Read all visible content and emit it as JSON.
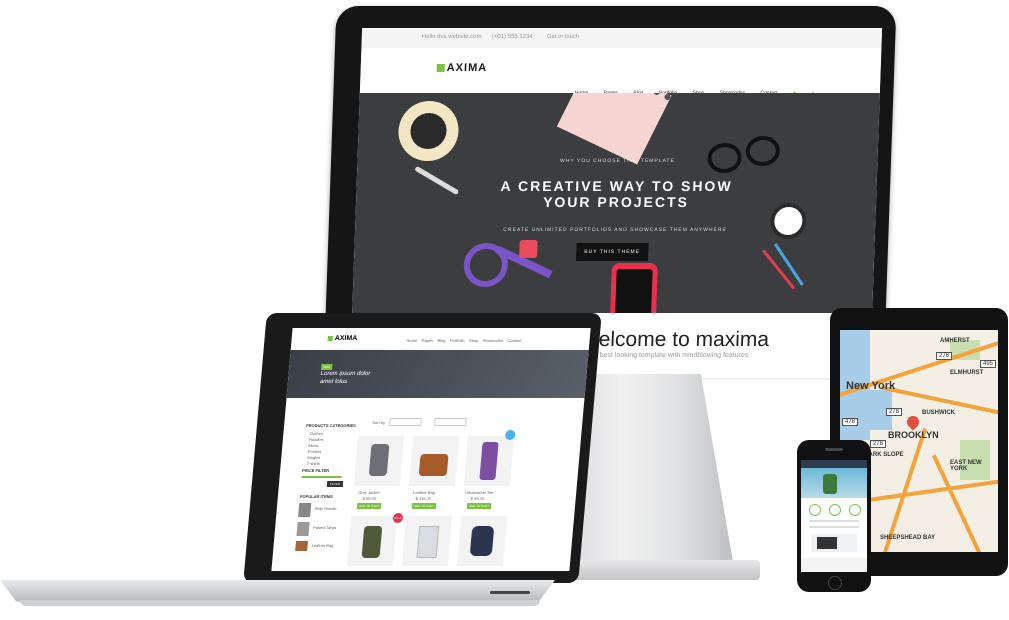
{
  "monitor": {
    "topbar": {
      "contact_email": "Hello this.website.com",
      "phone": "(+01) 555 1234",
      "address": "Get in touch"
    },
    "logo": "AXIMA",
    "nav": [
      "Home",
      "Pages",
      "Blog",
      "Portfolio",
      "Shop",
      "Shortcodes",
      "Contact"
    ],
    "hero": {
      "eyebrow": "WHY YOU CHOOSE THIS TEMPLATE",
      "title_line1": "A CREATIVE WAY TO SHOW",
      "title_line2": "YOUR PROJECTS",
      "subtitle": "CREATE UNLIMITED PORTFOLIOS AND SHOWCASE THEM ANYWHERE",
      "button": "BUY THIS THEME"
    },
    "welcome": {
      "title": "Welcome to maxima",
      "subtitle": "The best looking template with mindblowing features"
    }
  },
  "laptop": {
    "logo": "AXIMA",
    "nav": [
      "Home",
      "Pages",
      "Blog",
      "Portfolio",
      "Shop",
      "Shortcodes",
      "Contact"
    ],
    "hero_text_line1": "Lorem ipsum dolor",
    "hero_text_line2": "amet lolus",
    "badge": "NEW",
    "sidebar_title": "PRODUCTS CATEGORIES",
    "categories": [
      "Clothes",
      "Hoodies",
      "Music",
      "Posters",
      "Singles",
      "T-shirts"
    ],
    "price_filter": "PRICE FILTER",
    "filter_button": "FILTER",
    "popular_title": "POPULAR ITEMS",
    "popular_items": [
      "Ship Hoodie",
      "Patient Ninja",
      "Leather Bag"
    ],
    "sort_label": "Sort by",
    "products": [
      {
        "name": "Grey Jacket",
        "price": "$ 59.00",
        "button": "ADD TO CART"
      },
      {
        "name": "Leather Bag",
        "price": "$ 115.00",
        "button": "ADD TO CART"
      },
      {
        "name": "Ultramarine Tee",
        "price": "$ 29.00",
        "button": "ADD TO CART"
      }
    ],
    "sale_badge": "SALE"
  },
  "tablet": {
    "map_labels": [
      "New York",
      "BROOKLYN",
      "BUSHWICK",
      "EAST NEW YORK",
      "PARK SLOPE",
      "SHEEPSHEAD BAY",
      "AMHERST",
      "ELMHURST"
    ],
    "shields": [
      "278",
      "495",
      "278",
      "478",
      "278"
    ]
  },
  "colors": {
    "accent": "#7cc242",
    "hero_bg": "#3b3d3f",
    "map_road": "#f3a33a",
    "map_pin": "#e84c3d"
  }
}
